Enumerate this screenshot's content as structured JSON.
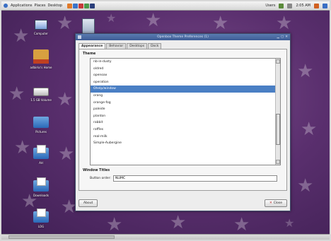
{
  "top_panel": {
    "menus": [
      "Applications",
      "Places",
      "Desktop"
    ],
    "users": "Users",
    "clock": "2:05 AM"
  },
  "desktop_icons": [
    {
      "label": "Computer"
    },
    {
      "label": "adbirks's Home"
    },
    {
      "label": "1.5 GB Volume"
    },
    {
      "label": "Pictures"
    },
    {
      "label": "AH"
    },
    {
      "label": "Downloads"
    },
    {
      "label": "LOG"
    }
  ],
  "dialog": {
    "title": "Openbox Theme Preferences (1)",
    "tabs": [
      "Appearance",
      "Behavior",
      "Desktops",
      "Dock"
    ],
    "theme_section": "Theme",
    "themes": [
      "nb-in-dusty",
      "oldred",
      "openoax",
      "operation",
      "Ohelp/window",
      "orang",
      "orange-fog",
      "paleide",
      "planton",
      "rabbit",
      "raffles",
      "real-milk",
      "Simple-Aubergine"
    ],
    "selected_theme_index": 4,
    "window_titles_section": "Window Titles",
    "button_order_label": "Button order:",
    "button_order_value": "NLIMC",
    "about_label": "About",
    "close_label": "Close"
  }
}
